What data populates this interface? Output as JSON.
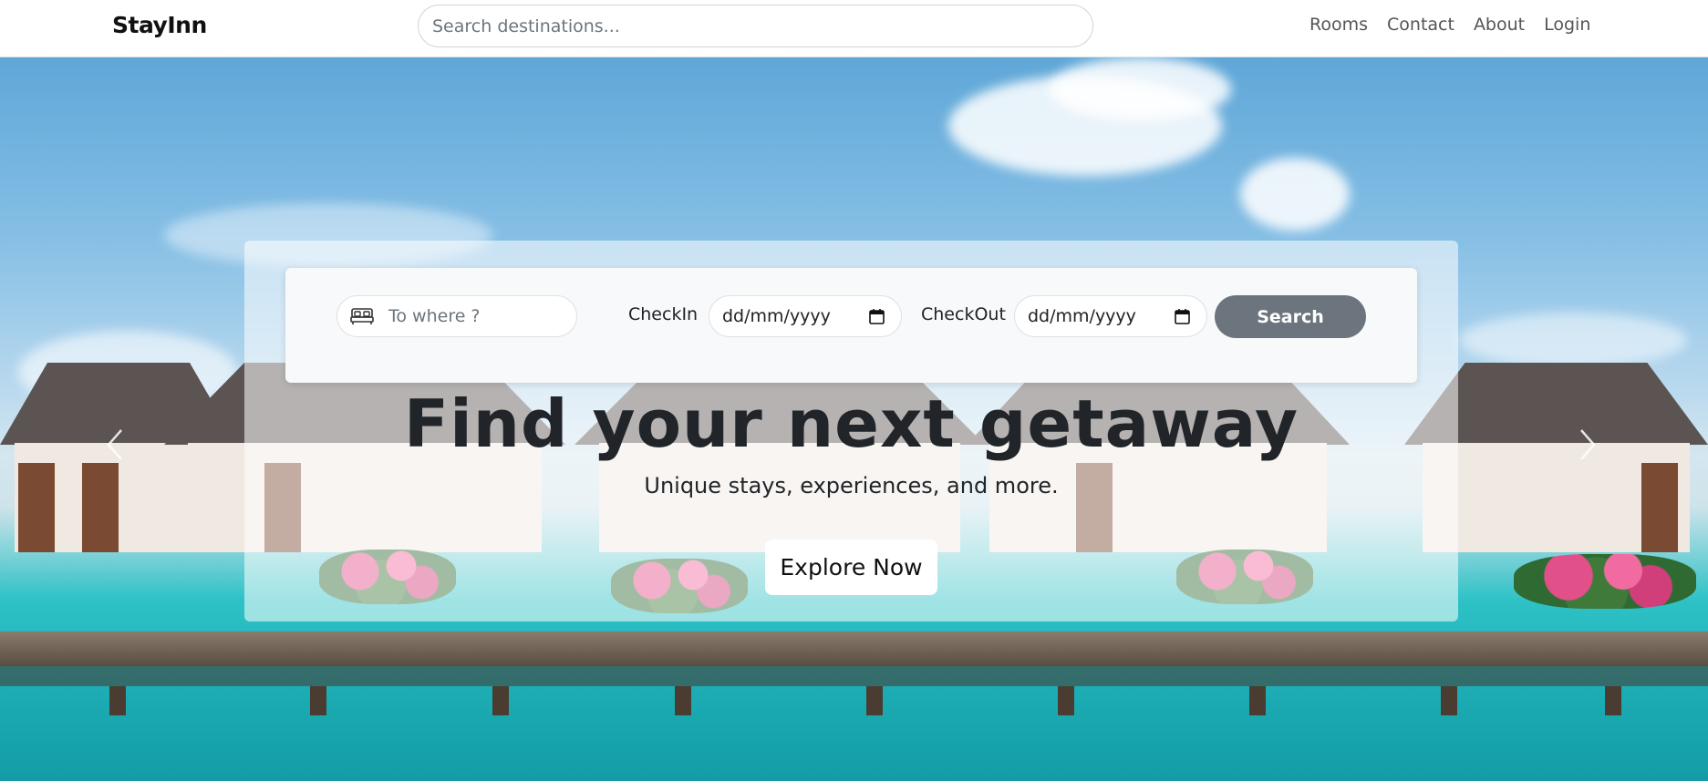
{
  "navbar": {
    "brand": "StayInn",
    "search_placeholder": "Search destinations...",
    "links": [
      "Rooms",
      "Contact",
      "About",
      "Login"
    ]
  },
  "hero": {
    "carousel": {
      "prev_icon": "chevron-left-icon",
      "next_icon": "chevron-right-icon"
    },
    "search_form": {
      "where_placeholder": "To where ?",
      "where_icon": "bed-icon",
      "checkin_label": "CheckIn",
      "checkin_value": "dd/mm/yyyy",
      "checkout_label": "CheckOut",
      "checkout_value": "dd/mm/yyyy",
      "date_icon": "calendar-icon",
      "search_label": "Search"
    },
    "headline": "Find your next getaway",
    "subline": "Unique stays, experiences, and more.",
    "cta_label": "Explore Now"
  },
  "colors": {
    "search_button": "#6c757d",
    "text": "#212529"
  }
}
